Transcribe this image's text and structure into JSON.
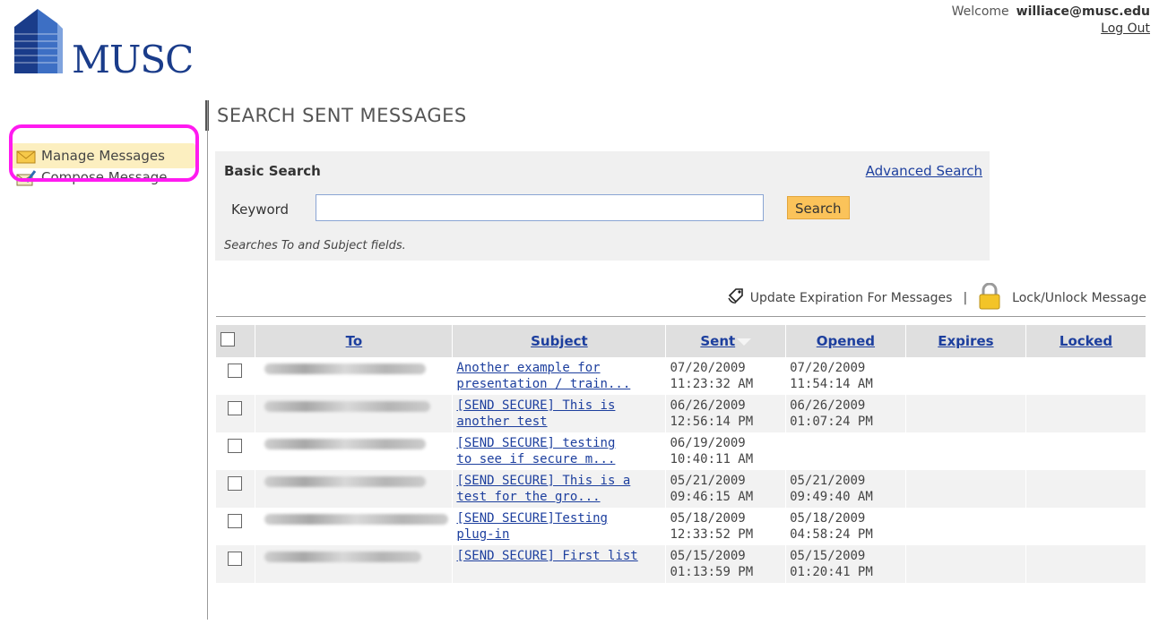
{
  "header": {
    "logo_text": "MUSC",
    "welcome_label": "Welcome",
    "user_email": "williace@musc.edu",
    "logout_label": "Log Out"
  },
  "sidebar": {
    "items": [
      {
        "label": "Manage Messages",
        "icon": "envelope-icon",
        "active": true
      },
      {
        "label": "Compose Message",
        "icon": "compose-icon",
        "active": false
      }
    ]
  },
  "main": {
    "title": "SEARCH SENT MESSAGES",
    "basic_search": {
      "title": "Basic Search",
      "advanced_link": "Advanced Search",
      "keyword_label": "Keyword",
      "keyword_value": "",
      "search_button": "Search",
      "hint": "Searches To and Subject fields."
    },
    "actions": {
      "update_expiration": "Update Expiration For Messages",
      "separator": "|",
      "lock_unlock": "Lock/Unlock Message"
    },
    "table": {
      "columns": [
        "To",
        "Subject",
        "Sent",
        "Opened",
        "Expires",
        "Locked"
      ],
      "sorted_column": "Sent",
      "rows": [
        {
          "to": "",
          "subject_line1": "Another example for",
          "subject_line2": "presentation / train...",
          "sent_date": "07/20/2009",
          "sent_time": "11:23:32 AM",
          "opened_date": "07/20/2009",
          "opened_time": "11:54:14 AM",
          "expires": "",
          "locked": ""
        },
        {
          "to": "",
          "subject_line1": "[SEND SECURE] This is",
          "subject_line2": "another test",
          "sent_date": "06/26/2009",
          "sent_time": "12:56:14 PM",
          "opened_date": "06/26/2009",
          "opened_time": "01:07:24 PM",
          "expires": "",
          "locked": ""
        },
        {
          "to": "",
          "subject_line1": "[SEND SECURE] testing",
          "subject_line2": "to see if secure m...",
          "sent_date": "06/19/2009",
          "sent_time": "10:40:11 AM",
          "opened_date": "",
          "opened_time": "",
          "expires": "",
          "locked": ""
        },
        {
          "to": "",
          "subject_line1": "[SEND SECURE] This is a",
          "subject_line2": "test for the gro...",
          "sent_date": "05/21/2009",
          "sent_time": "09:46:15 AM",
          "opened_date": "05/21/2009",
          "opened_time": "09:49:40 AM",
          "expires": "",
          "locked": ""
        },
        {
          "to": "",
          "subject_line1": "[SEND SECURE]Testing",
          "subject_line2": "plug-in",
          "sent_date": "05/18/2009",
          "sent_time": "12:33:52 PM",
          "opened_date": "05/18/2009",
          "opened_time": "04:58:24 PM",
          "expires": "",
          "locked": ""
        },
        {
          "to": "",
          "subject_line1": "[SEND SECURE] First list",
          "subject_line2": "",
          "sent_date": "05/15/2009",
          "sent_time": "01:13:59 PM",
          "opened_date": "05/15/2009",
          "opened_time": "01:20:41 PM",
          "expires": "",
          "locked": ""
        }
      ]
    }
  },
  "colors": {
    "brand_blue": "#1a3c8a",
    "link_blue": "#1d3f9e",
    "active_nav_bg": "#fcefc0",
    "search_button_bg": "#fbc35a",
    "highlight_ring": "#ff1af0"
  }
}
